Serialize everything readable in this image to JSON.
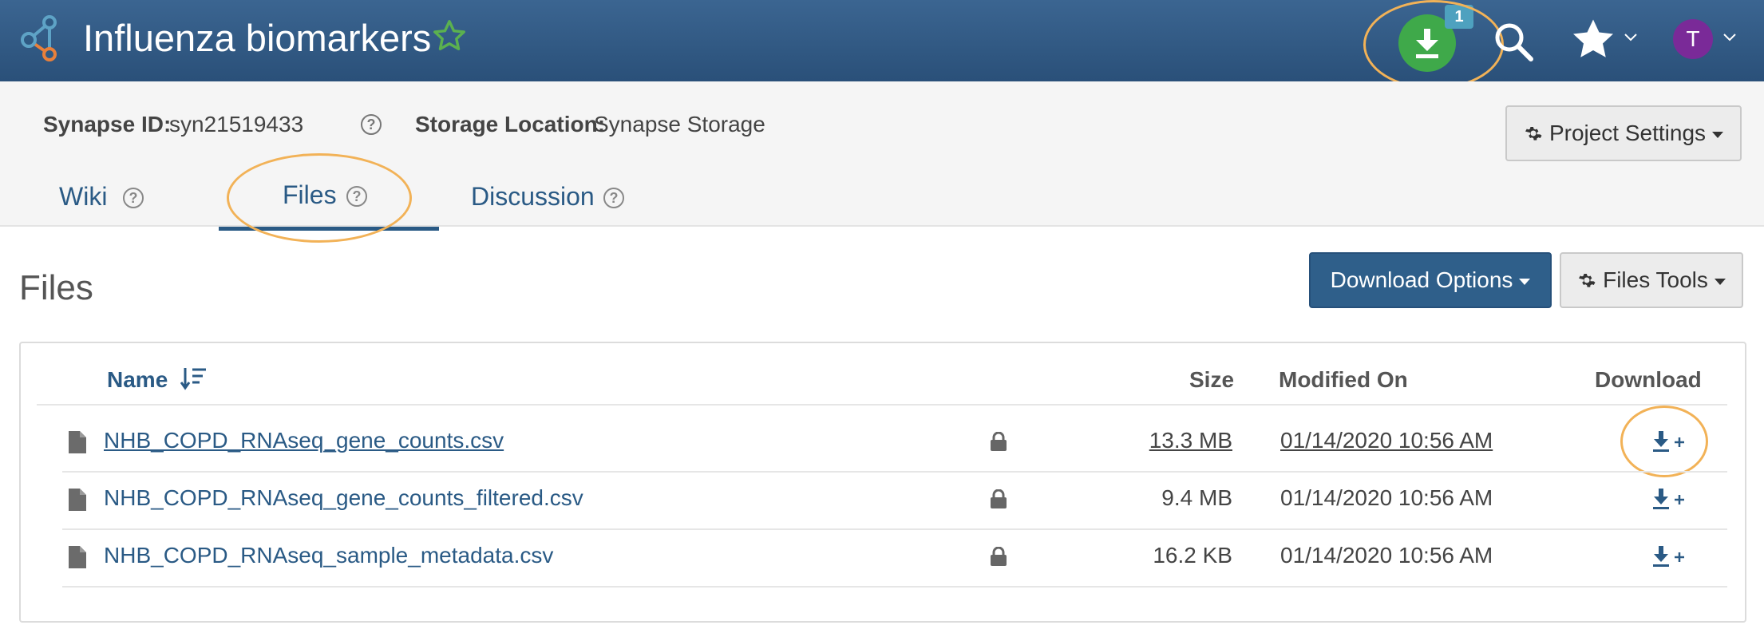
{
  "header": {
    "title": "Influenza biomarkers",
    "download_badge": "1",
    "avatar_initial": "T"
  },
  "meta": {
    "synapse_id_label": "Synapse ID:",
    "synapse_id_value": "syn21519433",
    "storage_label": "Storage Location:",
    "storage_value": "Synapse Storage",
    "project_settings_label": "Project Settings"
  },
  "tabs": [
    {
      "label": "Wiki"
    },
    {
      "label": "Files"
    },
    {
      "label": "Discussion"
    }
  ],
  "files": {
    "title": "Files",
    "download_options_label": "Download Options",
    "files_tools_label": "Files Tools",
    "columns": {
      "name": "Name",
      "size": "Size",
      "modified": "Modified On",
      "download": "Download"
    },
    "rows": [
      {
        "name": "NHB_COPD_RNAseq_gene_counts.csv",
        "size": "13.3 MB",
        "modified": "01/14/2020 10:56 AM"
      },
      {
        "name": "NHB_COPD_RNAseq_gene_counts_filtered.csv",
        "size": "9.4 MB",
        "modified": "01/14/2020 10:56 AM"
      },
      {
        "name": "NHB_COPD_RNAseq_sample_metadata.csv",
        "size": "16.2 KB",
        "modified": "01/14/2020 10:56 AM"
      }
    ]
  },
  "icons": {
    "logo": "synapse-logo-icon",
    "favorite": "star-outline-icon",
    "download_list": "download-icon",
    "search": "search-icon",
    "favorites_menu": "star-icon",
    "help": "help-circle-icon",
    "gear": "gear-icon",
    "sort": "sort-icon",
    "file": "file-icon",
    "lock": "lock-icon",
    "add_to_download": "download-add-icon"
  },
  "colors": {
    "header_bg": "#2f5a84",
    "accent_blue": "#2a5a85",
    "download_green": "#3fa94a",
    "badge": "#4ea1bf",
    "avatar": "#7a2a98",
    "highlight": "#f2b257"
  }
}
